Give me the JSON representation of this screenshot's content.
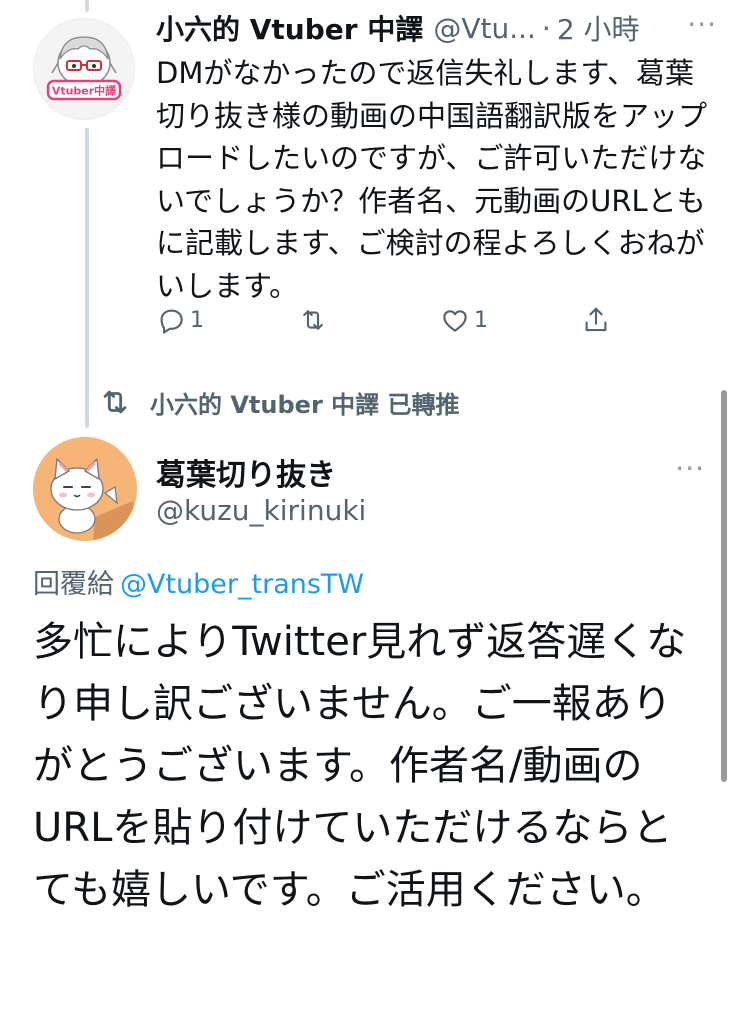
{
  "tweet1": {
    "display_name": "小六的 Vtuber 中譯",
    "handle": "@Vtu...",
    "separator": "·",
    "time": "2 小時",
    "more": "···",
    "avatar_label": "Vtuber中譯",
    "text": "DMがなかったので返信失礼します、葛葉切り抜き様の動画の中国語翻訳版をアップロードしたいのですが、ご許可いただけないでしょうか？作者名、元動画のURLともに記載します、ご検討の程よろしくおねがいします。",
    "reply_count": "1",
    "like_count": "1",
    "icons": [
      "reply-icon",
      "retweet-icon",
      "like-icon",
      "share-icon"
    ]
  },
  "retweet_banner": {
    "text": "小六的 Vtuber 中譯 已轉推"
  },
  "tweet2": {
    "display_name": "葛葉切り抜き",
    "handle": "@kuzu_kirinuki",
    "more": "···",
    "reply_prefix": "回覆給",
    "reply_mention": "@Vtuber_transTW",
    "text": "多忙によりTwitter見れず返答遅くなり申し訳ございません。ご一報ありがとうございます。作者名/動画のURLを貼り付けていただけるならとても嬉しいです。ご活用ください。"
  },
  "colors": {
    "accent": "#1d9bf0",
    "secondary_text": "#536471",
    "primary_text": "#0f1419",
    "logo_pink": "#e8407a"
  }
}
